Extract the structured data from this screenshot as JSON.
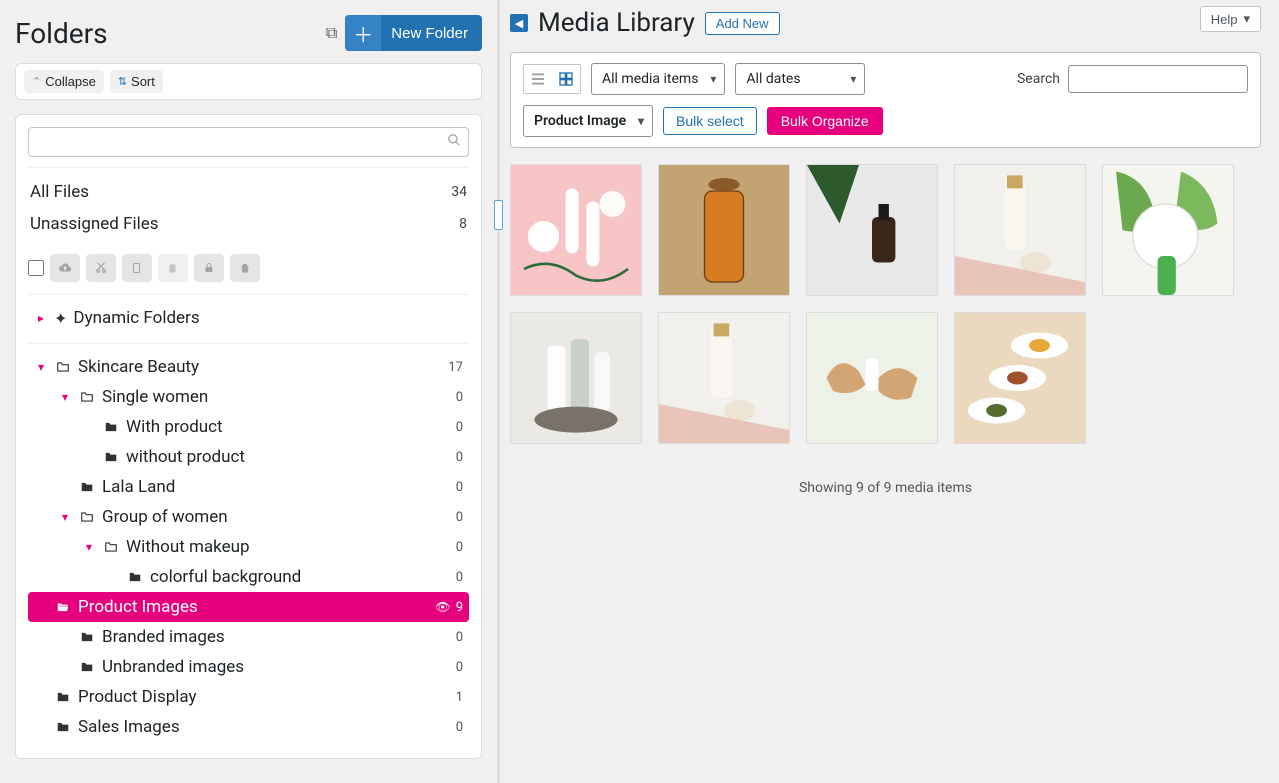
{
  "colors": {
    "accent_pink": "#e6007e",
    "accent_blue": "#2271b1"
  },
  "sidebar": {
    "title": "Folders",
    "new_folder_label": "New Folder",
    "collapse_label": "Collapse",
    "sort_label": "Sort",
    "all_files": {
      "label": "All Files",
      "count": 34
    },
    "unassigned": {
      "label": "Unassigned Files",
      "count": 8
    },
    "dynamic_folders_label": "Dynamic Folders",
    "tree": [
      {
        "label": "Skincare Beauty",
        "count": 17,
        "indent": 0,
        "caret": "open",
        "icon": "folder"
      },
      {
        "label": "Single women",
        "count": 0,
        "indent": 1,
        "caret": "open",
        "icon": "folder"
      },
      {
        "label": "With product",
        "count": 0,
        "indent": 2,
        "caret": "hidden",
        "icon": "folder-solid"
      },
      {
        "label": "without product",
        "count": 0,
        "indent": 2,
        "caret": "hidden",
        "icon": "folder-solid"
      },
      {
        "label": "Lala Land",
        "count": 0,
        "indent": 1,
        "caret": "hidden",
        "icon": "folder-solid"
      },
      {
        "label": "Group of women",
        "count": 0,
        "indent": 1,
        "caret": "open",
        "icon": "folder"
      },
      {
        "label": "Without makeup",
        "count": 0,
        "indent": 2,
        "caret": "open",
        "icon": "folder"
      },
      {
        "label": "colorful background",
        "count": 0,
        "indent": 3,
        "caret": "hidden",
        "icon": "folder-solid"
      },
      {
        "label": "Product Images",
        "count": 9,
        "indent": 0,
        "caret": "open",
        "icon": "folder-open",
        "selected": true,
        "eye": true
      },
      {
        "label": "Branded images",
        "count": 0,
        "indent": 1,
        "caret": "hidden",
        "icon": "folder-solid"
      },
      {
        "label": "Unbranded images",
        "count": 0,
        "indent": 1,
        "caret": "hidden",
        "icon": "folder-solid"
      },
      {
        "label": "Product Display",
        "count": 1,
        "indent": 0,
        "caret": "hidden",
        "icon": "folder-solid"
      },
      {
        "label": "Sales Images",
        "count": 0,
        "indent": 0,
        "caret": "hidden",
        "icon": "folder-solid"
      }
    ]
  },
  "main": {
    "help_label": "Help",
    "page_title": "Media Library",
    "add_new_label": "Add New",
    "filter_media": "All media items",
    "filter_dates": "All dates",
    "filter_folder": "Product Images",
    "search_label": "Search",
    "bulk_select_label": "Bulk select",
    "bulk_organize_label": "Bulk Organize",
    "showing_text": "Showing 9 of 9 media items"
  }
}
